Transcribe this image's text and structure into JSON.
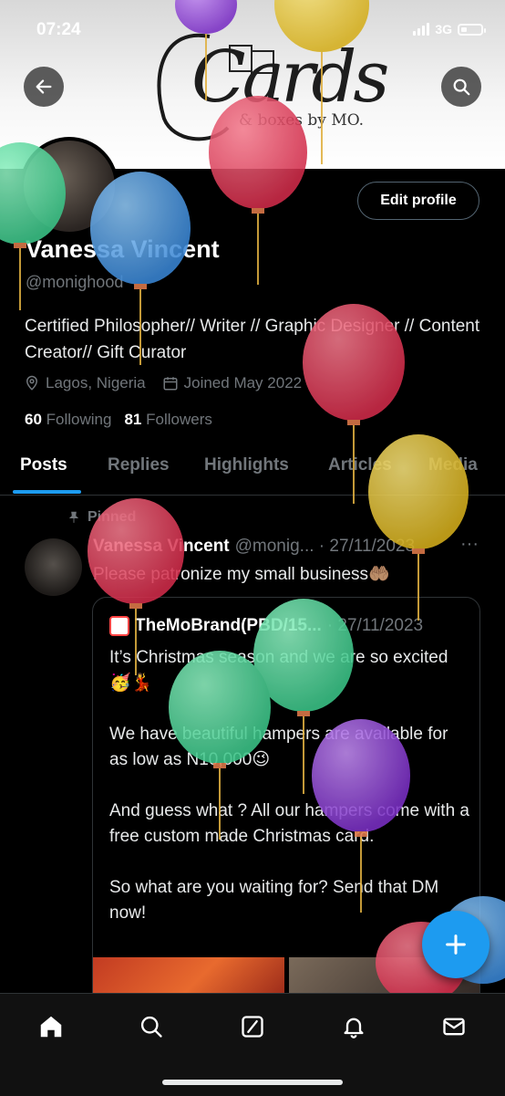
{
  "status": {
    "time": "07:24",
    "network": "3G"
  },
  "banner": {
    "logo_script": "Cards",
    "logo_sub": "& boxes by MO."
  },
  "profile": {
    "edit_label": "Edit profile",
    "name": "Vanessa Vincent",
    "handle": "@monighood",
    "bio": "Certified Philosopher// Writer // Graphic Designer // Content Creator// Gift Curator",
    "location": "Lagos, Nigeria",
    "joined": "Joined May 2022",
    "following_count": "60",
    "following_label": "Following",
    "followers_count": "81",
    "followers_label": "Followers"
  },
  "tabs": [
    "Posts",
    "Replies",
    "Highlights",
    "Articles",
    "Media"
  ],
  "post": {
    "pinned_label": "Pinned",
    "author": "Vanessa Vincent",
    "handle_date": "@monig... · 27/11/2023",
    "more": "···",
    "text": "Please patronize my small business🤲🏽",
    "quote": {
      "author": "TheMoBrand(PBD/15...",
      "date": "· 27/11/2023",
      "body": "It’s Christmas season and we are so excited🥳💃\n\nWe have beautiful hampers are available for as low as N10,000😉\n\nAnd guess what ? All our hampers come with a free custom made Christmas card.\n\nSo what are you waiting for? Send that DM now!"
    }
  },
  "icons": [
    "back-arrow-icon",
    "search-icon",
    "location-pin-icon",
    "calendar-icon",
    "pin-icon",
    "home-icon",
    "explore-icon",
    "grok-icon",
    "bell-icon",
    "mail-icon",
    "plus-icon"
  ],
  "colors": {
    "accent": "#1d9bf0",
    "background": "#000000",
    "muted": "#71767b"
  }
}
